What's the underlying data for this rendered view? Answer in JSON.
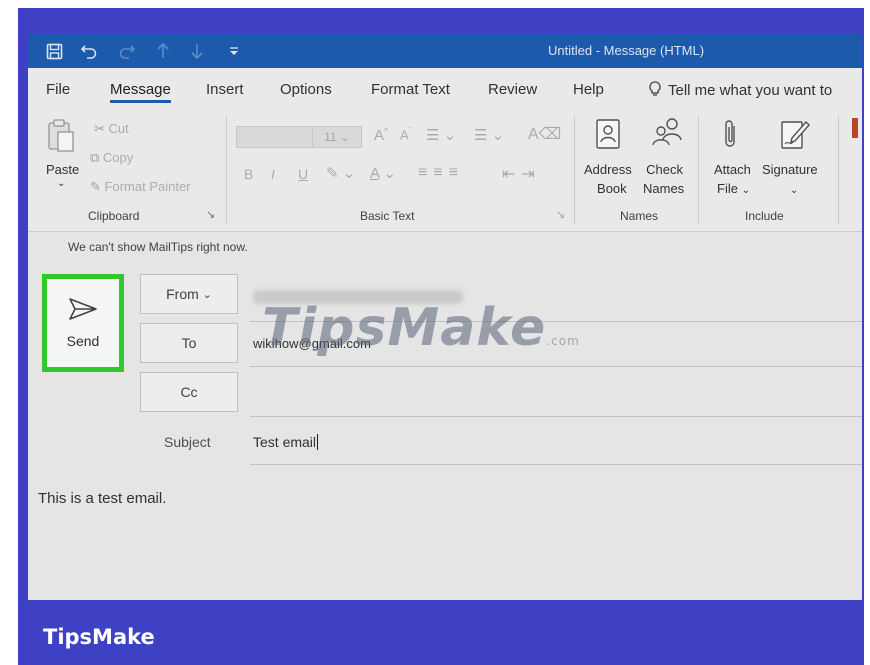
{
  "titlebar": {
    "title": "Untitled - Message (HTML)",
    "icons": [
      "save-icon",
      "undo-icon",
      "redo-icon",
      "up-arrow-icon",
      "down-arrow-icon",
      "customize-icon"
    ]
  },
  "tabs": [
    "File",
    "Message",
    "Insert",
    "Options",
    "Format Text",
    "Review",
    "Help",
    "Tell me what you want to"
  ],
  "active_tab": "Message",
  "ribbon": {
    "clipboard": {
      "label": "Clipboard",
      "paste": "Paste",
      "cut": "Cut",
      "copy": "Copy",
      "format_painter": "Format Painter"
    },
    "basic_text": {
      "label": "Basic Text",
      "font_size": "11",
      "bold": "B",
      "italic": "I",
      "underline": "U"
    },
    "names": {
      "label": "Names",
      "address_book_1": "Address",
      "address_book_2": "Book",
      "check_names_1": "Check",
      "check_names_2": "Names"
    },
    "include": {
      "label": "Include",
      "attach_file_1": "Attach",
      "attach_file_2": "File",
      "signature": "Signature"
    }
  },
  "mailtips": "We can't show MailTips right now.",
  "compose": {
    "send_label": "Send",
    "from_label": "From",
    "to_label": "To",
    "to_value": "wikihow@gmail.com",
    "cc_label": "Cc",
    "subject_label": "Subject",
    "subject_value": "Test email",
    "body": "This is a test email."
  },
  "watermark": {
    "text": "TipsMake",
    "suffix": ".com"
  },
  "brand": "TipsMake",
  "colors": {
    "outer_background": "#3e41c4",
    "titlebar": "#1e5fb4",
    "send_highlight": "#34d12f",
    "ribbon": "#f3f3f3"
  }
}
